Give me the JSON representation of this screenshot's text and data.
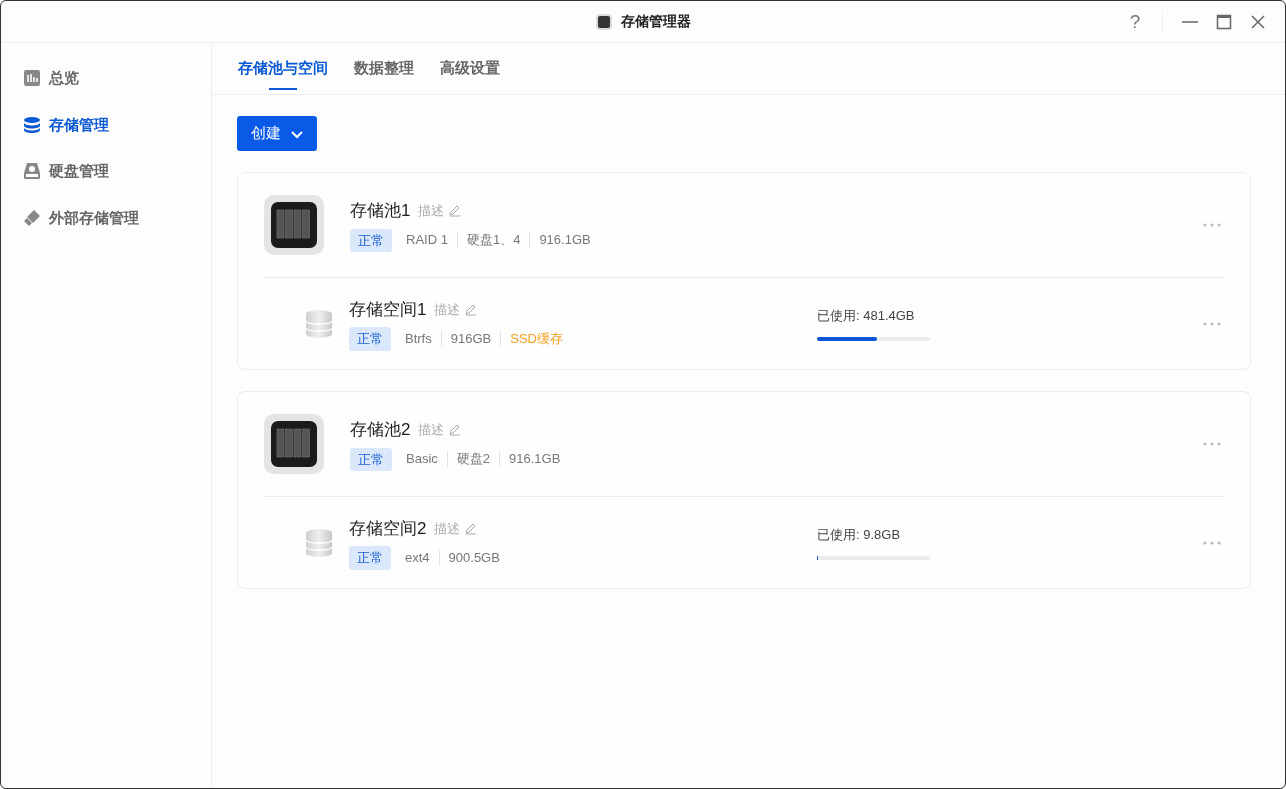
{
  "window": {
    "title": "存储管理器"
  },
  "title_bar_buttons": [
    {
      "kind": "help",
      "label": "?"
    },
    {
      "kind": "minimize"
    },
    {
      "kind": "maximize"
    },
    {
      "kind": "close"
    }
  ],
  "sidebar": {
    "items": [
      {
        "label": "总览",
        "kind": "chart",
        "selected": false
      },
      {
        "label": "存储管理",
        "kind": "database",
        "selected": true
      },
      {
        "label": "硬盘管理",
        "kind": "disk",
        "selected": false
      },
      {
        "label": "外部存储管理",
        "kind": "usb",
        "selected": false
      }
    ]
  },
  "tabs": [
    {
      "label": "存储池与空间",
      "selected": true
    },
    {
      "label": "数据整理",
      "selected": false
    },
    {
      "label": "高级设置",
      "selected": false
    }
  ],
  "create_button": {
    "label": "创建"
  },
  "pools": [
    {
      "name": "存储池1",
      "description": "描述",
      "status": "正常",
      "meta": [
        {
          "text": "RAID 1",
          "kind": "normal"
        },
        {
          "text": "硬盘1、4",
          "kind": "normal"
        },
        {
          "text": "916.1GB",
          "kind": "normal"
        }
      ],
      "volume": {
        "name": "存储空间1",
        "description": "描述",
        "status": "正常",
        "meta": [
          {
            "text": "Btrfs",
            "kind": "normal"
          },
          {
            "text": "916GB",
            "kind": "normal"
          },
          {
            "text": "SSD缓存",
            "kind": "accent"
          }
        ],
        "used": "已使用: 481.4GB",
        "level": 0.53
      }
    },
    {
      "name": "存储池2",
      "description": "描述",
      "status": "正常",
      "meta": [
        {
          "text": "Basic",
          "kind": "normal"
        },
        {
          "text": "硬盘2",
          "kind": "normal"
        },
        {
          "text": "916.1GB",
          "kind": "normal"
        }
      ],
      "volume": {
        "name": "存储空间2",
        "description": "描述",
        "status": "正常",
        "meta": [
          {
            "text": "ext4",
            "kind": "normal"
          },
          {
            "text": "900.5GB",
            "kind": "normal"
          }
        ],
        "used": "已使用: 9.8GB",
        "level": 0.011
      }
    }
  ]
}
